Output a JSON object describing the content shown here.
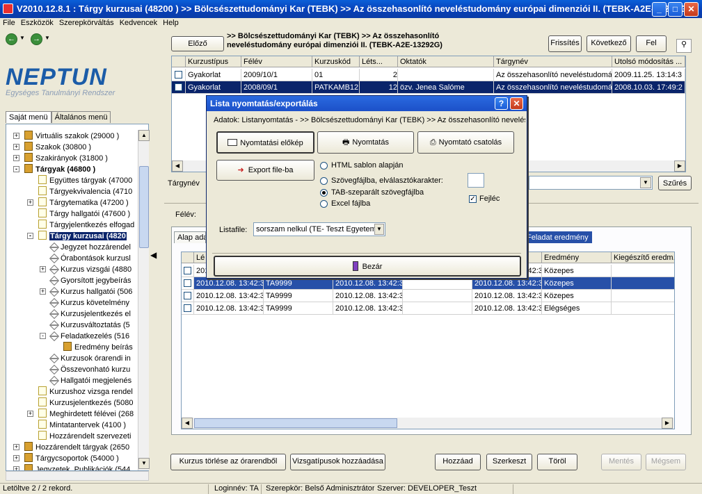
{
  "window": {
    "title": "V2010.12.8.1 : Tárgy kurzusai (48200 )   >> Bölcsészettudományi Kar (TEBK) >> Az összehasonlító neveléstudomány európai dimenziói II. (TEBK-A2E-13292G)"
  },
  "menu": [
    "File",
    "Eszközök",
    "Szerepkörváltás",
    "Kedvencek",
    "Help"
  ],
  "logo": {
    "name": "NEPTUN",
    "subtitle": "Egységes Tanulmányi Rendszer"
  },
  "left_tabs": [
    "Saját menü",
    "Általános menü"
  ],
  "tree": [
    {
      "label": "Virtuális szakok (29000 )",
      "icon": "cube",
      "level": 1,
      "exp": "+"
    },
    {
      "label": "Szakok (30800 )",
      "icon": "cube",
      "level": 1,
      "exp": "+"
    },
    {
      "label": "Szakirányok (31800 )",
      "icon": "cube",
      "level": 1,
      "exp": "+"
    },
    {
      "label": "Tárgyak (46800 )",
      "icon": "cube",
      "level": 1,
      "exp": "-",
      "bold": true
    },
    {
      "label": "Együttes tárgyak (47000",
      "icon": "doc",
      "level": 2
    },
    {
      "label": "Tárgyekvivalencia (4710",
      "icon": "doc",
      "level": 2
    },
    {
      "label": "Tárgytematika (47200 )",
      "icon": "doc",
      "level": 2,
      "exp": "+"
    },
    {
      "label": "Tárgy hallgatói (47600 )",
      "icon": "doc",
      "level": 2
    },
    {
      "label": "Tárgyjelentkezés elfogad",
      "icon": "doc",
      "level": 2
    },
    {
      "label": "Tárgy kurzusai (4820",
      "icon": "doc",
      "level": 2,
      "exp": "-",
      "bold": true,
      "selected": true
    },
    {
      "label": "Jegyzet hozzárendel",
      "icon": "wrench",
      "level": 3
    },
    {
      "label": "Órabontások kurzusl",
      "icon": "wrench",
      "level": 3
    },
    {
      "label": "Kurzus vizsgái (4880",
      "icon": "wrench",
      "level": 3,
      "exp": "+"
    },
    {
      "label": "Gyorsított jegybeírás",
      "icon": "wrench",
      "level": 3
    },
    {
      "label": "Kurzus hallgatói (506",
      "icon": "wrench",
      "level": 3,
      "exp": "+"
    },
    {
      "label": "Kurzus követelmény",
      "icon": "wrench",
      "level": 3
    },
    {
      "label": "Kurzusjelentkezés el",
      "icon": "wrench",
      "level": 3
    },
    {
      "label": "Kurzusváltoztatás (5",
      "icon": "wrench",
      "level": 3
    },
    {
      "label": "Feladatkezelés (516",
      "icon": "wrench",
      "level": 3,
      "exp": "-"
    },
    {
      "label": "Eredmény beírás",
      "icon": "cube",
      "level": 4
    },
    {
      "label": "Kurzusok órarendi in",
      "icon": "wrench",
      "level": 3
    },
    {
      "label": "Összevonható kurzu",
      "icon": "wrench",
      "level": 3
    },
    {
      "label": "Hallgatói megjelenés",
      "icon": "wrench",
      "level": 3
    },
    {
      "label": "Kurzushoz vizsga rendel",
      "icon": "doc",
      "level": 2
    },
    {
      "label": "Kurzusjelentkezés (5080",
      "icon": "doc",
      "level": 2
    },
    {
      "label": "Meghirdetett félévei (268",
      "icon": "doc",
      "level": 2,
      "exp": "+"
    },
    {
      "label": "Mintatantervek (4100 )",
      "icon": "doc",
      "level": 2
    },
    {
      "label": "Hozzárendelt szervezeti",
      "icon": "doc",
      "level": 2
    },
    {
      "label": "Hozzárendelt tárgyak (2650",
      "icon": "cube",
      "level": 1,
      "exp": "+"
    },
    {
      "label": "Tárgycsoportok (54000 )",
      "icon": "cube",
      "level": 1,
      "exp": "+"
    },
    {
      "label": "Jegyzetek, Publikációk (544",
      "icon": "cube",
      "level": 1,
      "exp": "+"
    }
  ],
  "top_buttons": {
    "prev": "Előző",
    "refresh": "Frissítés",
    "next": "Következő",
    "up": "Fel"
  },
  "breadcrumb": {
    "line1": ">> Bölcsészettudományi Kar (TEBK) >> Az összehasonlító",
    "line2": "neveléstudomány európai dimenziói II. (TEBK-A2E-13292G)"
  },
  "course_grid": {
    "columns": [
      "Kurzustípus",
      "Félév",
      "Kurzuskód",
      "Léts...",
      "Oktatók",
      "Tárgynév",
      "Utolsó módosítás ..."
    ],
    "rows": [
      [
        "Gyakorlat",
        "2009/10/1",
        "01",
        "2",
        "",
        "Az összehasonlító neveléstudomán",
        "2009.11.25. 13:14:3"
      ],
      [
        "Gyakorlat",
        "2008/09/1",
        "PATKAMB12",
        "12",
        "özv. Jenea Salóme",
        "Az összehasonlító neveléstudomán",
        "2008.10.03. 17:49:2"
      ]
    ]
  },
  "filter": {
    "targyname_label": "Tárgynév",
    "search_btn": "Szűrés",
    "felev_label": "Félév:"
  },
  "lower_tabs": {
    "first": "Alap ada",
    "active": "Feladat eredmény"
  },
  "result_grid": {
    "columns": [
      "Lé",
      "",
      "",
      "",
      "uma",
      "Eredmény",
      "Kiegészítő eredm."
    ],
    "rows": [
      [
        "2010.12.08. 13:42:3",
        "TA9999",
        "2010.12.08. 13:42:3",
        "",
        "2010.12.08. 13:42:3",
        "Közepes",
        ""
      ],
      [
        "2010.12.08. 13:42:3",
        "TA9999",
        "2010.12.08. 13:42:3",
        "",
        "2010.12.08. 13:42:3",
        "Közepes",
        ""
      ],
      [
        "2010.12.08. 13:42:3",
        "TA9999",
        "2010.12.08. 13:42:3",
        "",
        "2010.12.08. 13:42:3",
        "Közepes",
        ""
      ],
      [
        "2010.12.08. 13:42:3",
        "TA9999",
        "2010.12.08. 13:42:3",
        "",
        "2010.12.08. 13:42:3",
        "Elégséges",
        ""
      ]
    ]
  },
  "bottom_buttons": {
    "delete_timetable": "Kurzus törlése az órarendből",
    "add_exam_types": "Vizsgatípusok hozzáadása",
    "add": "Hozzáad",
    "edit": "Szerkeszt",
    "delete": "Töröl",
    "save": "Mentés",
    "cancel": "Mégsem"
  },
  "dialog": {
    "title": "Lista nyomtatás/exportálás",
    "data_line": "Adatok:  Listanyomtatás - >> Bölcsészettudományi Kar (TEBK) >> Az összehasonlító neveléstu",
    "btn_preview": "Nyomtatási előkép",
    "btn_print": "Nyomtatás",
    "btn_printer": "Nyomtató csatolás",
    "btn_export": "Export file-ba",
    "radio_html": "HTML sablon alapján",
    "radio_text": "Szövegfájlba, elválasztókarakter:",
    "radio_tab": "TAB-szeparált szövegfájlba",
    "radio_excel": "Excel fájlba",
    "header_chk": "Fejléc",
    "listfile_label": "Listafile:",
    "listfile_value": "sorszam nelkul   (TE- Teszt Egyetem",
    "close_btn": "Bezár"
  },
  "status": {
    "records": "Letöltve 2 / 2 rekord.",
    "login": "Loginnév: TA",
    "role": "Szerepkör: Belső Adminisztrátor",
    "server": "Szerver: DEVELOPER_Teszt"
  }
}
